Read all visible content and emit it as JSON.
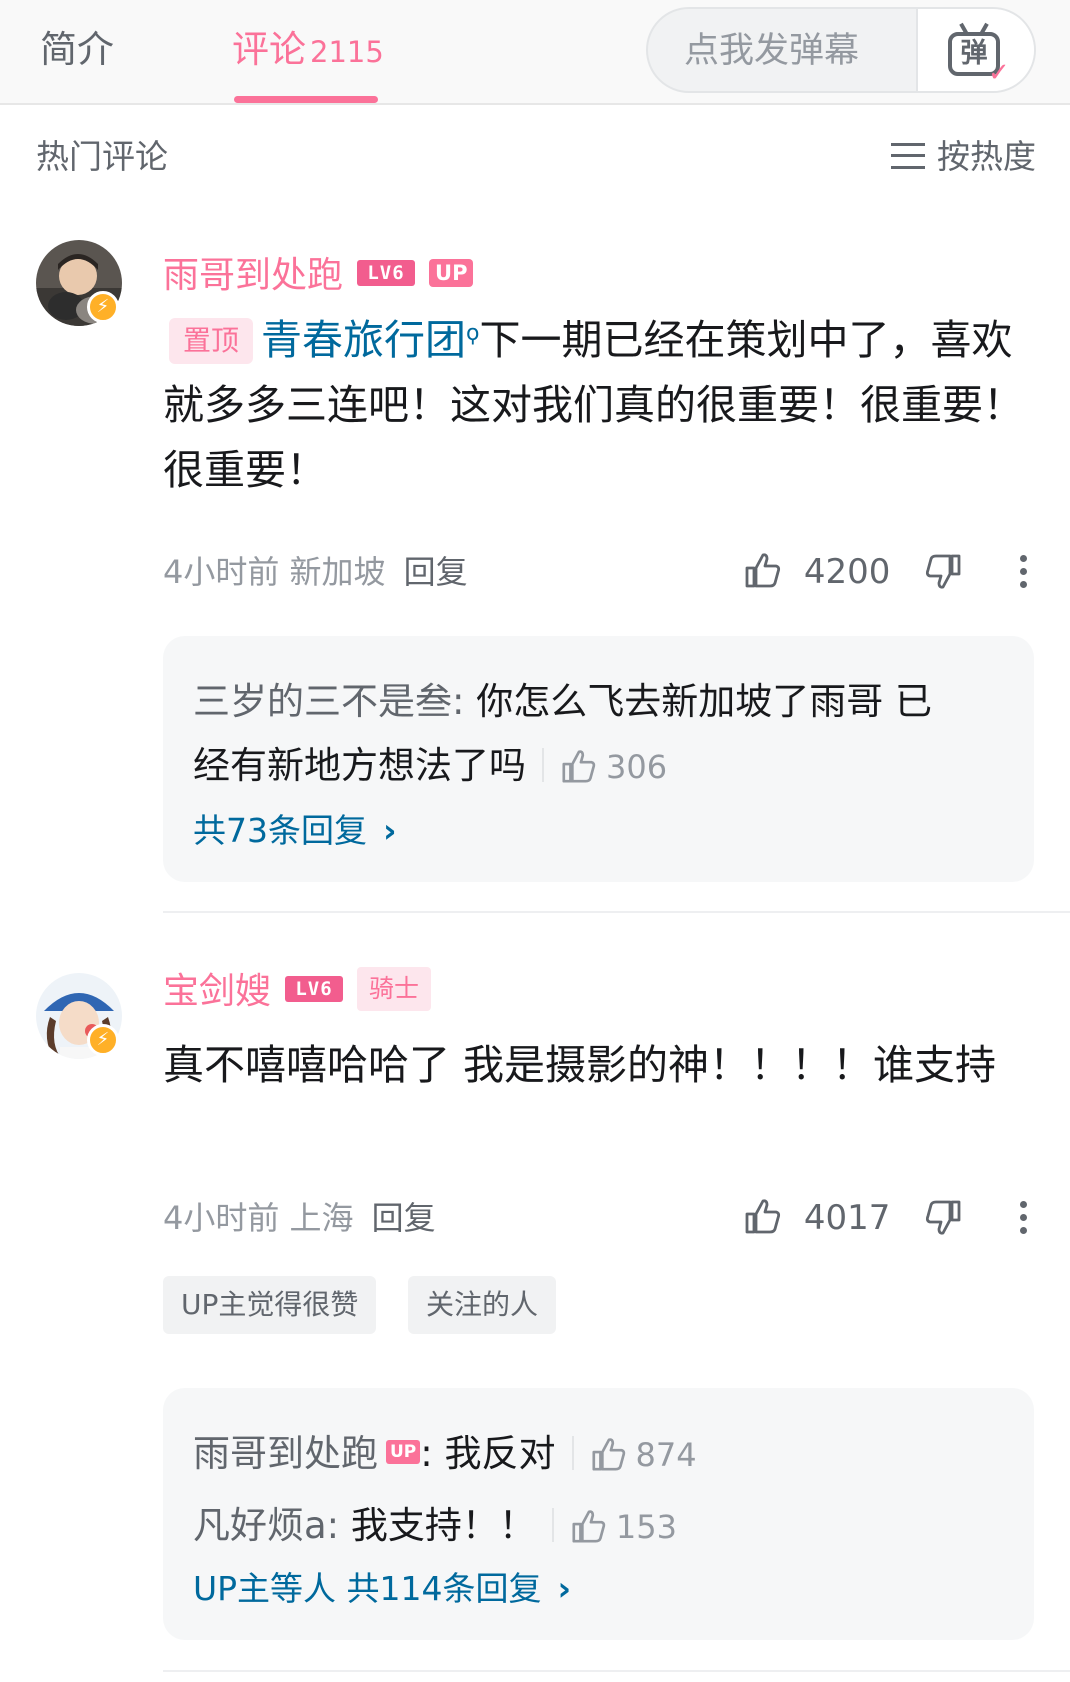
{
  "tabs": {
    "intro": "简介",
    "comments": "评论",
    "comment_count": "2115"
  },
  "danmaku": {
    "placeholder": "点我发弹幕",
    "button_glyph": "弹",
    "check_glyph": "✓"
  },
  "section": {
    "title": "热门评论",
    "sort": "按热度"
  },
  "comments": [
    {
      "username": "雨哥到处跑",
      "level": "LV6",
      "tag": "UP",
      "pin_label": "置顶",
      "topic": "青春旅行团",
      "topic_glyph": "ϙ",
      "text": "下一期已经在策划中了，喜欢就多多三连吧！这对我们真的很重要！很重要！很重要！",
      "time": "4小时前",
      "location": "新加坡",
      "reply_label": "回复",
      "likes": "4200",
      "replies": [
        {
          "name": "三岁的三不是叁:",
          "text": " 你怎么飞去新加坡了雨哥 已",
          "text_cont": "经有新地方想法了吗",
          "likes": "306"
        }
      ],
      "more_replies": "共73条回复"
    },
    {
      "username": "宝剑嫂",
      "level": "LV6",
      "tag": "骑士",
      "text": "真不嘻嘻哈哈了 我是摄影的神！！！！谁支持",
      "time": "4小时前",
      "location": "上海",
      "reply_label": "回复",
      "likes": "4017",
      "chips": [
        "UP主觉得很赞",
        "关注的人"
      ],
      "replies": [
        {
          "name": "雨哥到处跑",
          "up_tag": "UP",
          "text": ": 我反对",
          "likes": "874"
        },
        {
          "name": "凡好烦a:",
          "text": " 我支持！！",
          "likes": "153"
        }
      ],
      "more_replies": "UP主等人 共114条回复"
    }
  ],
  "colors": {
    "accent": "#fb7299",
    "link": "#00699d",
    "text": "#18191c",
    "secondary": "#61666d",
    "muted": "#9499a0"
  }
}
